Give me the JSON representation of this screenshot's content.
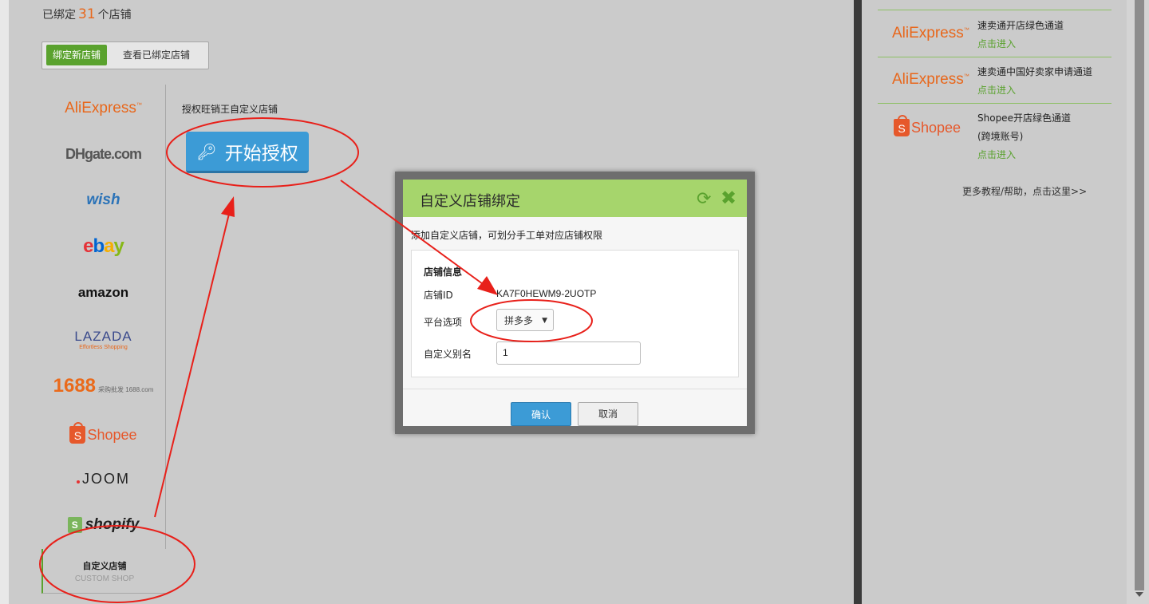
{
  "header": {
    "bound_prefix": "已绑定",
    "bound_count": "31",
    "bound_suffix": "个店铺"
  },
  "tabs": {
    "bind_new": "绑定新店铺",
    "view_bound": "查看已绑定店铺"
  },
  "platforms": [
    {
      "name": "AliExpress"
    },
    {
      "name": "DHgate.com"
    },
    {
      "name": "wish"
    },
    {
      "name": "ebay"
    },
    {
      "name": "amazon"
    },
    {
      "name": "LAZADA",
      "tagline": "Effortless Shopping"
    },
    {
      "name": "1688",
      "tagline": "采购批发 1688.com"
    },
    {
      "name": "Shopee"
    },
    {
      "name": "JOOM"
    },
    {
      "name": "shopify"
    }
  ],
  "custom_shop": {
    "title": "自定义店铺",
    "subtitle": "CUSTOM SHOP"
  },
  "auth": {
    "title": "授权旺销王自定义店铺",
    "button_label": "开始授权"
  },
  "dialog": {
    "title": "自定义店铺绑定",
    "description": "添加自定义店铺，可划分手工单对应店铺权限",
    "section_title": "店铺信息",
    "shop_id_label": "店铺ID",
    "shop_id_value": "KA7F0HEWM9-2UOTP",
    "platform_label": "平台选项",
    "platform_value": "拼多多",
    "alias_label": "自定义别名",
    "alias_value": "1",
    "confirm_label": "确认",
    "cancel_label": "取消",
    "refresh_icon": "refresh-icon",
    "close_icon": "close-icon"
  },
  "right_panel": {
    "items": [
      {
        "logo": "AliExpress",
        "text": "速卖通开店绿色通道",
        "link": "点击进入"
      },
      {
        "logo": "AliExpress",
        "text": "速卖通中国好卖家申请通道",
        "link": "点击进入"
      },
      {
        "logo": "Shopee",
        "text": "Shopee开店绿色通道",
        "text2": "(跨境账号)",
        "link": "点击进入"
      }
    ],
    "help_text": "更多教程/帮助，点击这里>>"
  },
  "colors": {
    "accent_green": "#5aa22e",
    "header_green": "#a6d56c",
    "button_blue": "#3c9bd6",
    "brand_orange": "#e8671b",
    "annotation_red": "#e8201a"
  }
}
